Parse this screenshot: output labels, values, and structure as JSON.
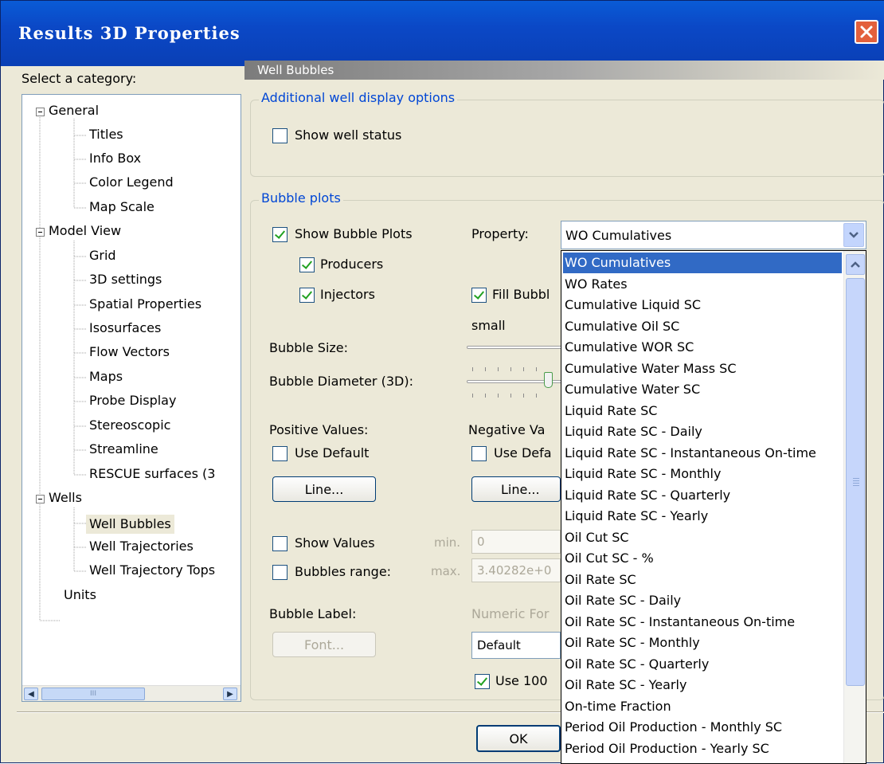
{
  "window": {
    "title": "Results 3D Properties"
  },
  "sidebar": {
    "prompt": "Select a category:",
    "items": [
      {
        "label": "General"
      },
      {
        "label": "Titles"
      },
      {
        "label": "Info Box"
      },
      {
        "label": "Color Legend"
      },
      {
        "label": "Map Scale"
      },
      {
        "label": "Model View"
      },
      {
        "label": "Grid"
      },
      {
        "label": "3D settings"
      },
      {
        "label": "Spatial Properties"
      },
      {
        "label": "Isosurfaces"
      },
      {
        "label": "Flow Vectors"
      },
      {
        "label": "Maps"
      },
      {
        "label": "Probe Display"
      },
      {
        "label": "Stereoscopic"
      },
      {
        "label": "Streamline"
      },
      {
        "label": "RESCUE surfaces (3"
      },
      {
        "label": "Wells"
      },
      {
        "label": "Well Bubbles"
      },
      {
        "label": "Well Trajectories"
      },
      {
        "label": "Well Trajectory Tops"
      },
      {
        "label": "Units"
      }
    ],
    "scroll_thumb_label": "III"
  },
  "main": {
    "header": "Well Bubbles",
    "additional": {
      "group_title": "Additional well display options",
      "show_status_label": "Show well status"
    },
    "bubble": {
      "group_title": "Bubble plots",
      "show_plots_label": "Show Bubble Plots",
      "property_label": "Property:",
      "property_value": "WO Cumulatives",
      "producers_label": "Producers",
      "injectors_label": "Injectors",
      "fill_label": "Fill Bubbl",
      "small_label": "small",
      "size_label": "Bubble Size:",
      "diameter_label": "Bubble Diameter (3D):",
      "positive_label": "Positive Values:",
      "negative_label": "Negative Va",
      "use_default_label": "Use Default",
      "use_default_neg_label": "Use Defa",
      "line_label": "Line...",
      "line_neg_label": "Line...",
      "show_values_label": "Show Values",
      "bubbles_range_label": "Bubbles range:",
      "min_label": "min.",
      "max_label": "max.",
      "min_value": "0",
      "max_value": "3.40282e+0",
      "label_label": "Bubble Label:",
      "font_label": "Font...",
      "numeric_label": "Numeric For",
      "format_value": "Default",
      "use1000_label": "Use 100"
    },
    "dropdown_options": [
      "WO Cumulatives",
      "WO Rates",
      "Cumulative Liquid SC",
      "Cumulative Oil SC",
      "Cumulative WOR SC",
      "Cumulative Water Mass SC",
      "Cumulative Water SC",
      "Liquid Rate SC",
      "Liquid Rate SC - Daily",
      "Liquid Rate SC - Instantaneous On-time",
      "Liquid Rate SC - Monthly",
      "Liquid Rate SC - Quarterly",
      "Liquid Rate SC - Yearly",
      "Oil Cut SC",
      "Oil Cut SC - %",
      "Oil Rate SC",
      "Oil Rate SC - Daily",
      "Oil Rate SC - Instantaneous On-time",
      "Oil Rate SC - Monthly",
      "Oil Rate SC - Quarterly",
      "Oil Rate SC - Yearly",
      "On-time Fraction",
      "Period Oil Production - Monthly SC",
      "Period Oil Production - Yearly SC"
    ]
  },
  "footer": {
    "ok_label": "OK"
  },
  "colors": {
    "titlebar": "#0a4fc8",
    "group_title": "#0046d5",
    "selection": "#316ac5",
    "dialog_bg": "#ece9d8"
  }
}
